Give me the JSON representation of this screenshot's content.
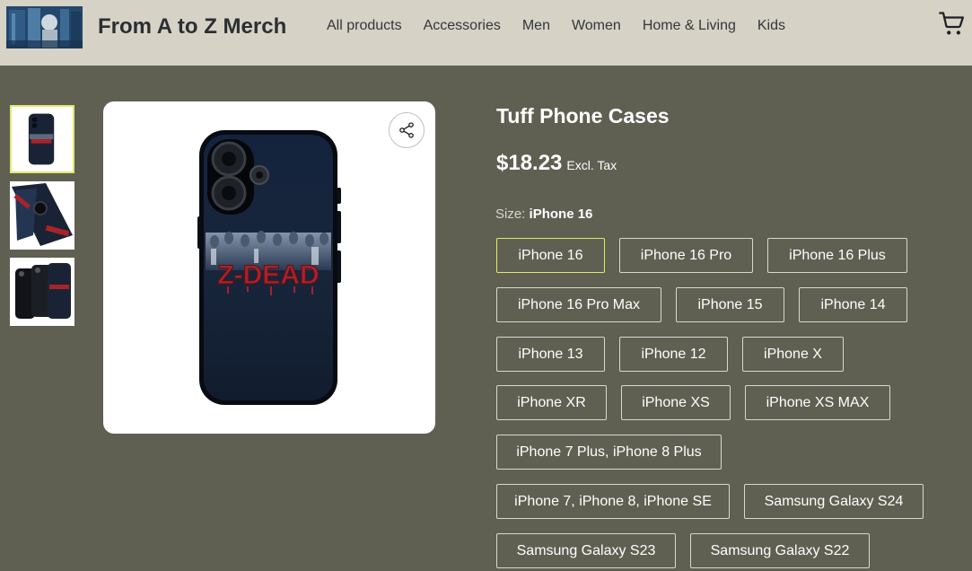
{
  "header": {
    "store_name": "From A to Z Merch",
    "nav": [
      "All products",
      "Accessories",
      "Men",
      "Women",
      "Home & Living",
      "Kids"
    ]
  },
  "product": {
    "title": "Tuff Phone Cases",
    "price": "$18.23",
    "tax_note": "Excl. Tax",
    "size_label": "Size:",
    "size_value": "iPhone 16",
    "case_text": "Z-DEAD",
    "options": [
      {
        "label": "iPhone 16",
        "selected": true
      },
      {
        "label": "iPhone 16 Pro",
        "selected": false
      },
      {
        "label": "iPhone 16 Plus",
        "selected": false
      },
      {
        "label": "iPhone 16 Pro Max",
        "selected": false
      },
      {
        "label": "iPhone 15",
        "selected": false
      },
      {
        "label": "iPhone 14",
        "selected": false
      },
      {
        "label": "iPhone 13",
        "selected": false
      },
      {
        "label": "iPhone 12",
        "selected": false
      },
      {
        "label": "iPhone X",
        "selected": false
      },
      {
        "label": "iPhone XR",
        "selected": false
      },
      {
        "label": "iPhone XS",
        "selected": false
      },
      {
        "label": "iPhone XS MAX",
        "selected": false
      },
      {
        "label": "iPhone 7 Plus, iPhone 8 Plus",
        "selected": false
      },
      {
        "label": "iPhone 7, iPhone 8, iPhone SE",
        "selected": false
      },
      {
        "label": "Samsung Galaxy S24",
        "selected": false
      },
      {
        "label": "Samsung Galaxy S23",
        "selected": false
      },
      {
        "label": "Samsung Galaxy S22",
        "selected": false
      }
    ]
  },
  "icons": {
    "cart": "cart-icon",
    "share": "share-icon"
  },
  "colors": {
    "page_bg": "#5f6052",
    "header_bg": "#d6d2c5",
    "selected_accent": "#e3e86a",
    "case_text": "#a8232a"
  }
}
